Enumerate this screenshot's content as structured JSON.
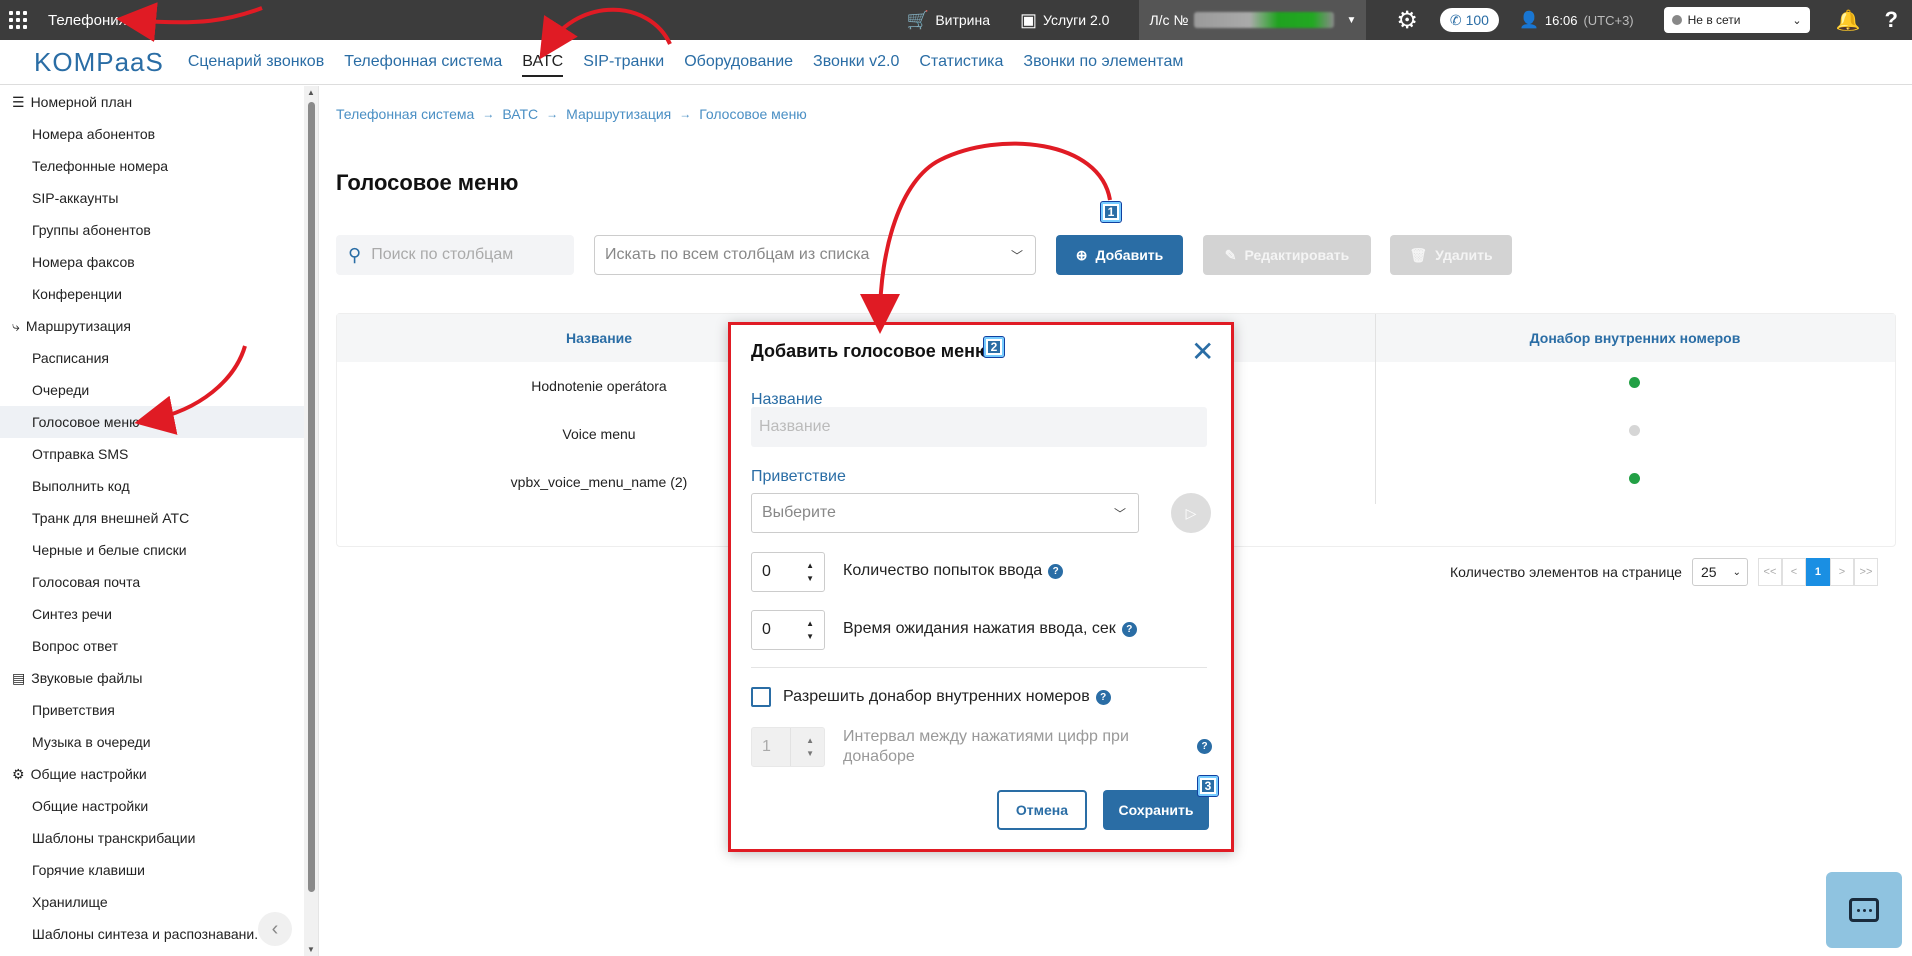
{
  "topbar": {
    "app_title": "Телефония",
    "showcase_label": "Витрина",
    "services_label": "Услуги 2.0",
    "account_prefix": "Л/с №",
    "phone_count": "100",
    "time": "16:06",
    "timezone": "(UTC+3)",
    "status_value": "Не в сети",
    "status_color": "#888888"
  },
  "mainnav": {
    "logo": "KOMPaaS",
    "links": [
      "Сценарий звонков",
      "Телефонная система",
      "ВАТС",
      "SIP-транки",
      "Оборудование",
      "Звонки v2.0",
      "Статистика",
      "Звонки по элементам"
    ],
    "active": "ВАТС"
  },
  "sidebar": {
    "sections": [
      {
        "title": "Номерной план",
        "icon": "list-icon",
        "items": [
          "Номера абонентов",
          "Телефонные номера",
          "SIP-аккаунты",
          "Группы абонентов",
          "Номера факсов",
          "Конференции"
        ]
      },
      {
        "title": "Маршрутизация",
        "icon": "routing-icon",
        "items": [
          "Расписания",
          "Очереди",
          "Голосовое меню",
          "Отправка SMS",
          "Выполнить код",
          "Транк для внешней АТС",
          "Черные и белые списки",
          "Голосовая почта",
          "Синтез речи",
          "Вопрос ответ"
        ]
      },
      {
        "title": "Звуковые файлы",
        "icon": "files-icon",
        "items": [
          "Приветствия",
          "Музыка в очереди"
        ]
      },
      {
        "title": "Общие настройки",
        "icon": "gear-icon",
        "items": [
          "Общие настройки",
          "Шаблоны транскрибации",
          "Горячие клавиши",
          "Хранилище",
          "Шаблоны синтеза и распознавани."
        ]
      }
    ],
    "active_item": "Голосовое меню"
  },
  "breadcrumb": [
    "Телефонная система",
    "ВАТС",
    "Маршрутизация",
    "Голосовое меню"
  ],
  "page": {
    "title": "Голосовое меню",
    "search_placeholder": "Поиск по столбцам",
    "column_select_placeholder": "Искать по всем столбцам из списка",
    "add_label": "Добавить",
    "edit_label": "Редактировать",
    "delete_label": "Удалить"
  },
  "table": {
    "columns": [
      "Название",
      "Донабор внутренних номеров"
    ],
    "rows": [
      {
        "name": "Hodnotenie operátora",
        "dial_status": "on"
      },
      {
        "name": "Voice menu",
        "dial_status": "off"
      },
      {
        "name": "vpbx_voice_menu_name (2)",
        "dial_status": "on"
      }
    ],
    "status_colors": {
      "on": "#22a045",
      "off": "#d6d6d6"
    }
  },
  "pager": {
    "label": "Количество элементов на странице",
    "page_size": "25",
    "first": "<<",
    "prev": "<",
    "current": "1",
    "next": ">",
    "last": ">>"
  },
  "modal": {
    "title": "Добавить голосовое меню",
    "name_label": "Название",
    "name_placeholder": "Название",
    "greeting_label": "Приветствие",
    "greeting_placeholder": "Выберите",
    "attempts_value": "0",
    "attempts_label": "Количество попыток ввода",
    "timeout_value": "0",
    "timeout_label": "Время ожидания нажатия ввода, сек",
    "allow_dial_label": "Разрешить донабор внутренних номеров",
    "interval_value": "1",
    "interval_label": "Интервал между нажатиями цифр при донаборе",
    "cancel_label": "Отмена",
    "save_label": "Сохранить"
  },
  "badges": [
    "1",
    "2",
    "3"
  ]
}
